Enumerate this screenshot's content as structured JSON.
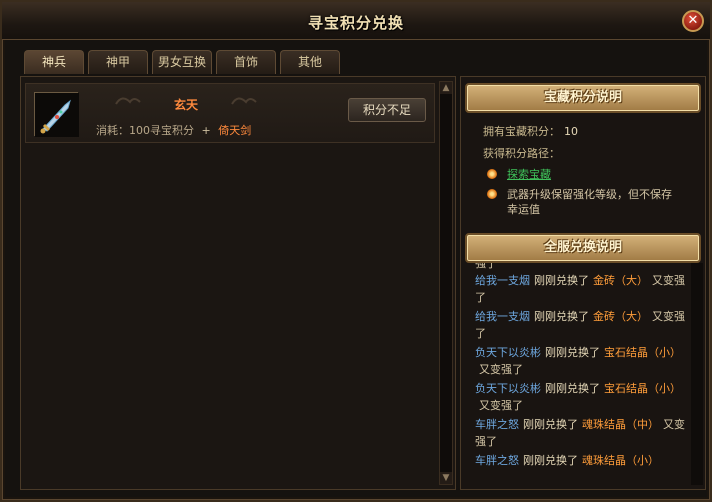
{
  "window": {
    "title": "寻宝积分兑换",
    "close": "✕"
  },
  "tabs": [
    "神兵",
    "神甲",
    "男女互换",
    "首饰",
    "其他"
  ],
  "item": {
    "name": "玄天",
    "cost_label": "消耗：100寻宝积分",
    "plus": "+",
    "cost_item": "倚天剑",
    "button": "积分不足"
  },
  "info": {
    "banner": "宝藏积分说明",
    "owned_label": "拥有宝藏积分：",
    "owned_value": "10",
    "route_label": "获得积分路径：",
    "route1": "探索宝藏",
    "route2": "武器升级保留强化等级，但不保存幸运值"
  },
  "log": {
    "banner": "全服兑换说明",
    "clipped": "强了",
    "entries": [
      {
        "player": "给我一支烟",
        "verb": "刚刚兑换了",
        "prize": "金砖（大）",
        "tail": "又变强了"
      },
      {
        "player": "给我一支烟",
        "verb": "刚刚兑换了",
        "prize": "金砖（大）",
        "tail": "又变强了"
      },
      {
        "player": "负天下以炎彬",
        "verb": "刚刚兑换了",
        "prize": "宝石结晶（小）",
        "tail": "又变强了"
      },
      {
        "player": "负天下以炎彬",
        "verb": "刚刚兑换了",
        "prize": "宝石结晶（小）",
        "tail": "又变强了"
      },
      {
        "player": "车胖之怒",
        "verb": "刚刚兑换了",
        "prize": "魂珠结晶（中）",
        "tail": "又变强了"
      },
      {
        "player": "车胖之怒",
        "verb": "刚刚兑换了",
        "prize": "魂珠结晶（小）",
        "tail": ""
      }
    ]
  },
  "colors": {
    "accent": "#ff8a3d",
    "player": "#6ea8e0",
    "route_green": "#3fc25a"
  }
}
